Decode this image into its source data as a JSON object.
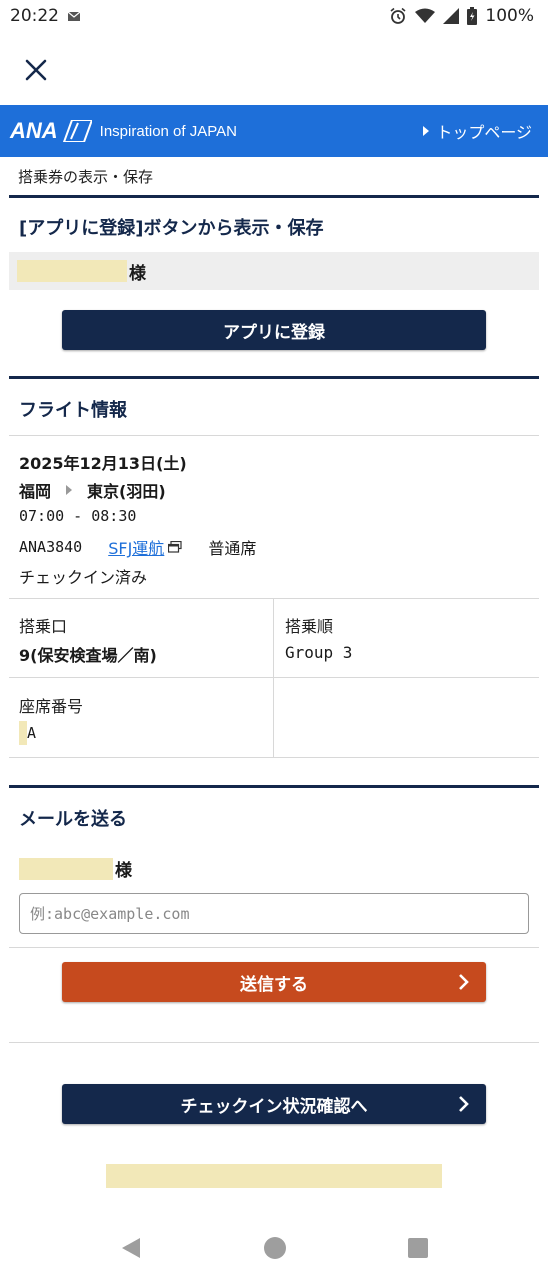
{
  "status_bar": {
    "time": "20:22",
    "battery": "100%",
    "icons": [
      "mail-notification-icon",
      "alarm-icon",
      "wifi-icon",
      "signal-icon",
      "battery-icon"
    ]
  },
  "close_icon": "close-icon",
  "header": {
    "logo": "ANA",
    "tagline": "Inspiration of JAPAN",
    "top_link": "トップページ",
    "colors": {
      "header_bg": "#1e6fd9",
      "navy": "#14284b",
      "orange": "#c64a1e"
    }
  },
  "breadcrumb": "搭乗券の表示・保存",
  "app_section": {
    "title": "[アプリに登録]ボタンから表示・保存",
    "name_suffix": "様",
    "button": "アプリに登録"
  },
  "flight_section": {
    "title": "フライト情報",
    "date": "2025年12月13日(土)",
    "origin": "福岡",
    "destination": "東京(羽田)",
    "time": "07:00 - 08:30",
    "flight_number": "ANA3840",
    "operator_link": "SFJ運航",
    "seat_class": "普通席",
    "status": "チェックイン済み",
    "gate_label": "搭乗口",
    "gate_value": "9(保安検査場／南)",
    "boarding_order_label": "搭乗順",
    "boarding_order_value": "Group 3",
    "seat_label": "座席番号",
    "seat_value": "A"
  },
  "mail_section": {
    "title": "メールを送る",
    "name_suffix": "様",
    "email_placeholder": "例:abc@example.com",
    "send_button": "送信する"
  },
  "checkin_button": "チェックイン状況確認へ",
  "nav_icons": [
    "back-icon",
    "home-icon",
    "recents-icon"
  ]
}
